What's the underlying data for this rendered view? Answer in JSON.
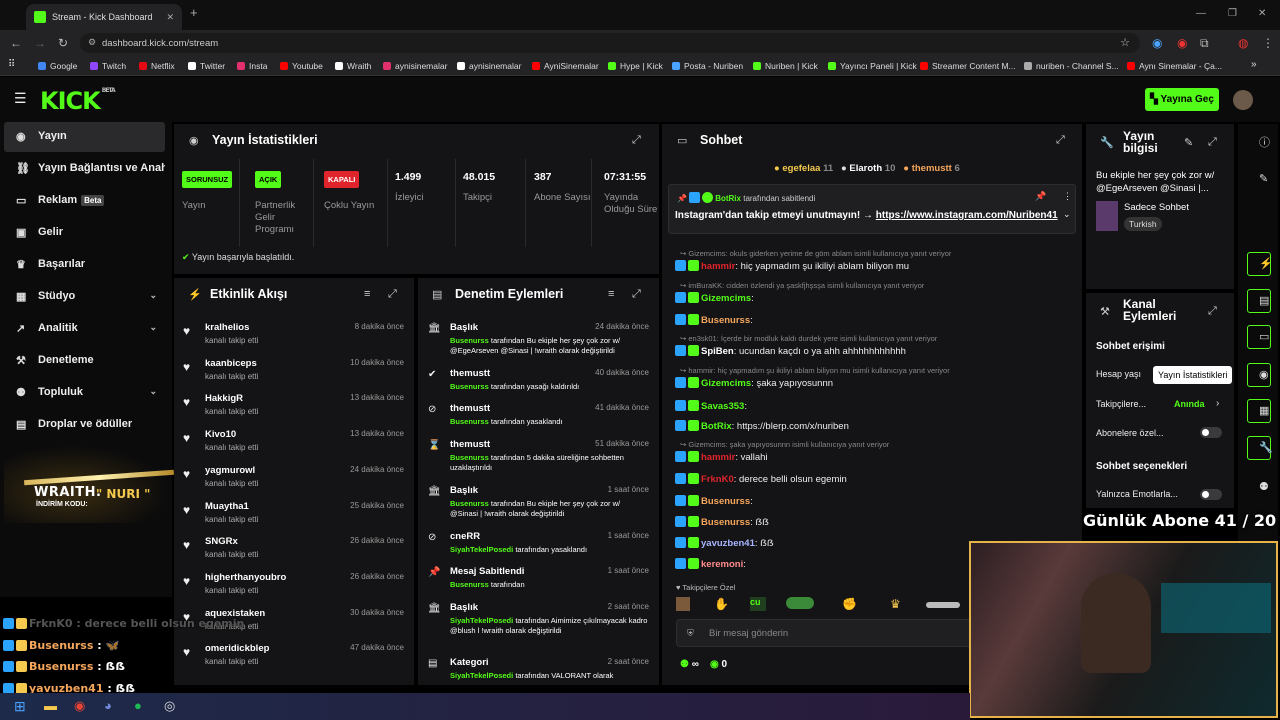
{
  "browser": {
    "tab_title": "Stream - Kick Dashboard",
    "url": "dashboard.kick.com/stream",
    "bookmarks": [
      "Google",
      "Twitch",
      "Netflix",
      "Twitter",
      "Insta",
      "Youtube",
      "Wraith",
      "aynisinemalar",
      "aynisinemalar",
      "AyniSinemalar",
      "Hype | Kick",
      "Posta - Nuriben",
      "Nuriben | Kick",
      "Yayıncı Paneli | Kick",
      "Streamer Content M...",
      "nuriben - Channel S...",
      "Aynı Sinemalar - Ça..."
    ]
  },
  "header": {
    "logo": "KICK",
    "logo_beta": "BETA",
    "go_live": "Yayına Geç"
  },
  "sidebar": {
    "items": [
      {
        "label": "Yayın"
      },
      {
        "label": "Yayın Bağlantısı ve Anahtarı"
      },
      {
        "label": "Reklam",
        "badge": "Beta"
      },
      {
        "label": "Gelir"
      },
      {
        "label": "Başarılar"
      },
      {
        "label": "Stüdyo"
      },
      {
        "label": "Analitik"
      },
      {
        "label": "Denetleme"
      },
      {
        "label": "Topluluk"
      },
      {
        "label": "Droplar ve ödüller"
      }
    ],
    "promo": {
      "brand": "WRAITH.",
      "code": "\" NURI \"",
      "caption": "İNDİRİM KODU:"
    }
  },
  "stats": {
    "title": "Yayın İstatistikleri",
    "cells": [
      {
        "badge": "SORUNSUZ",
        "badge_color": "#53fc18",
        "label": "Yayın"
      },
      {
        "badge": "AÇIK",
        "badge_color": "#53fc18",
        "label": "Partnerlik Gelir Programı"
      },
      {
        "badge": "KAPALI",
        "badge_color": "#e0242b",
        "label": "Çoklu Yayın"
      },
      {
        "value": "1.499",
        "label": "İzleyici"
      },
      {
        "value": "48.015",
        "label": "Takipçi"
      },
      {
        "value": "387",
        "label": "Abone Sayısı"
      },
      {
        "value": "07:31:55",
        "label": "Yayında Olduğu Süre"
      }
    ],
    "status": "Yayın başarıyla başlatıldı."
  },
  "activity": {
    "title": "Etkinlik Akışı",
    "action": "kanalı takip etti",
    "items": [
      {
        "name": "kralhelios",
        "time": "8 dakika önce"
      },
      {
        "name": "kaanbiceps",
        "time": "10 dakika önce"
      },
      {
        "name": "HakkigR",
        "time": "13 dakika önce"
      },
      {
        "name": "Kivo10",
        "time": "13 dakika önce"
      },
      {
        "name": "yagmurowl",
        "time": "24 dakika önce"
      },
      {
        "name": "Muaytha1",
        "time": "25 dakika önce"
      },
      {
        "name": "SNGRx",
        "time": "26 dakika önce"
      },
      {
        "name": "higherthanyoubro",
        "time": "26 dakika önce"
      },
      {
        "name": "aquexistaken",
        "time": "30 dakika önce"
      },
      {
        "name": "omeridickblep",
        "time": "47 dakika önce"
      }
    ]
  },
  "moderation": {
    "title": "Denetim Eylemleri",
    "items": [
      {
        "icon": "🏛",
        "title": "Başlık",
        "time": "24 dakika önce",
        "user": "Busenurss",
        "text": "tarafından Bu ekiple her şey çok zor w/ @EgeArseven @Sinasi | !wraith olarak değiştirildi"
      },
      {
        "icon": "✔",
        "title": "themustt",
        "time": "40 dakika önce",
        "user": "Busenurss",
        "text": "tarafından yasağı kaldırıldı"
      },
      {
        "icon": "⊘",
        "title": "themustt",
        "time": "41 dakika önce",
        "user": "Busenurss",
        "text": "tarafından yasaklandı"
      },
      {
        "icon": "⌛",
        "title": "themustt",
        "time": "51 dakika önce",
        "user": "Busenurss",
        "text": "tarafından 5 dakika süreliğine sohbetten uzaklaştırıldı"
      },
      {
        "icon": "🏛",
        "title": "Başlık",
        "time": "1 saat önce",
        "user": "Busenurss",
        "text": "tarafından Bu ekiple her şey çok zor w/ @Sinasi | !wraith olarak değiştirildi"
      },
      {
        "icon": "⊘",
        "title": "cneRR",
        "time": "1 saat önce",
        "user": "SiyahTekelPosedi",
        "text": "tarafından yasaklandı"
      },
      {
        "icon": "📌",
        "title": "Mesaj Sabitlendi",
        "time": "1 saat önce",
        "user": "Busenurss",
        "text": "tarafından"
      },
      {
        "icon": "🏛",
        "title": "Başlık",
        "time": "2 saat önce",
        "user": "SiyahTekelPosedi",
        "text": "tarafından Aimimize çıkılmayacak kadro @blush l !wraith olarak değiştirildi"
      },
      {
        "icon": "▤",
        "title": "Kategori",
        "time": "2 saat önce",
        "user": "SiyahTekelPosedi",
        "text": "tarafından VALORANT olarak"
      }
    ]
  },
  "chat": {
    "title": "Sohbet",
    "top": [
      {
        "name": "egefelaa",
        "n": "11",
        "c": "#f5c94e"
      },
      {
        "name": "Elaroth",
        "n": "10",
        "c": "#fff"
      },
      {
        "name": "themustt",
        "n": "6",
        "c": "#f5a65b"
      }
    ],
    "pinned": {
      "by": "BotRix",
      "by_suffix": "tarafından sabitlendi",
      "text": "Instagram'dan takip etmeyi unutmayın! →",
      "link": "https://www.instagram.com/Nuriben41"
    },
    "messages": [
      {
        "type": "user",
        "name": "hammir",
        "color": "#e0242b",
        "text": "hiç yapmadım şu ikiliyi ablam biliyon mu",
        "reply": "Gizemcims: okuls giderken yerime de göm ablam isimli kullanıcıya yanıt veriyor"
      },
      {
        "type": "user",
        "name": "Gizemcims",
        "color": "#53fc18",
        "text": "",
        "reply": "imBuraKK: cidden özlendi ya şaskfjhşsşa isimli kullanıcıya yanıt veriyor"
      },
      {
        "type": "user",
        "name": "Busenurss",
        "color": "#f5a65b",
        "text": ""
      },
      {
        "type": "user",
        "name": "SpiBen",
        "color": "#fff",
        "text": "ucundan kaçdı o ya ahh ahhhhhhhhhhh",
        "reply": "en3sk01: İçerde bir modluk kaldı durdek yere isimli kullanıcıya yanıt veriyor"
      },
      {
        "type": "user",
        "name": "Gizemcims",
        "color": "#53fc18",
        "text": "şaka yapıyosunnn",
        "reply": "hammir: hiç yapmadım şu ikiliyi ablam biliyon mu isimli kullanıcıya yanıt veriyor"
      },
      {
        "type": "user",
        "name": "Savas353",
        "color": "#53fc18",
        "text": ""
      },
      {
        "type": "user",
        "name": "BotRix",
        "color": "#53fc18",
        "text": "https://blerp.com/x/nuriben"
      },
      {
        "type": "user",
        "name": "hammir",
        "color": "#e0242b",
        "text": "vallahi",
        "reply": "Gizemcims: şaka yapıyosunnn isimli kullanıcıya yanıt veriyor"
      },
      {
        "type": "user",
        "name": "FrknK0",
        "color": "#e0242b",
        "text": "derece belli olsun egemin"
      },
      {
        "type": "user",
        "name": "Busenurss",
        "color": "#f5a65b",
        "text": ""
      },
      {
        "type": "user",
        "name": "Busenurss",
        "color": "#f5a65b",
        "text": "ẞẞ"
      },
      {
        "type": "user",
        "name": "yavuzben41",
        "color": "#a8b4ff",
        "text": "ẞẞ"
      },
      {
        "type": "user",
        "name": "keremoni",
        "color": "#ff8c8c",
        "text": ""
      }
    ],
    "emote_label": "Takipçilere Özel",
    "input_placeholder": "Bir mesaj gönderin",
    "stat_a": "∞",
    "stat_b": "0"
  },
  "stream_info": {
    "title": "Yayın bilgisi",
    "stream_title": "Bu ekiple her şey çok zor w/ @EgeArseven @Sinasi |...",
    "mode": "Sadece Sohbet",
    "tag": "Turkish"
  },
  "channel_actions": {
    "title": "Kanal Eylemleri",
    "chat_access": "Sohbet erişimi",
    "account_age": "Hesap yaşı",
    "followers": "Takipçilere...",
    "followers_value": "Anında",
    "subs": "Abonelere özel...",
    "chat_options": "Sohbet seçenekleri",
    "emotes_only": "Yalnızca Emotlarla..."
  },
  "tooltip": "Yayın İstatistikleri",
  "overlay": {
    "sub_goal": "Günlük Abone 41 / 20",
    "chat": [
      {
        "name": "FrknK0",
        "text": "derece belli olsun egemin"
      },
      {
        "name": "Busenurss",
        "text": "🦋"
      },
      {
        "name": "Busenurss",
        "text": "ẞẞ"
      },
      {
        "name": "yavuzben41",
        "text": "ẞẞ"
      },
      {
        "name": "keremoni",
        "text": ""
      }
    ]
  }
}
